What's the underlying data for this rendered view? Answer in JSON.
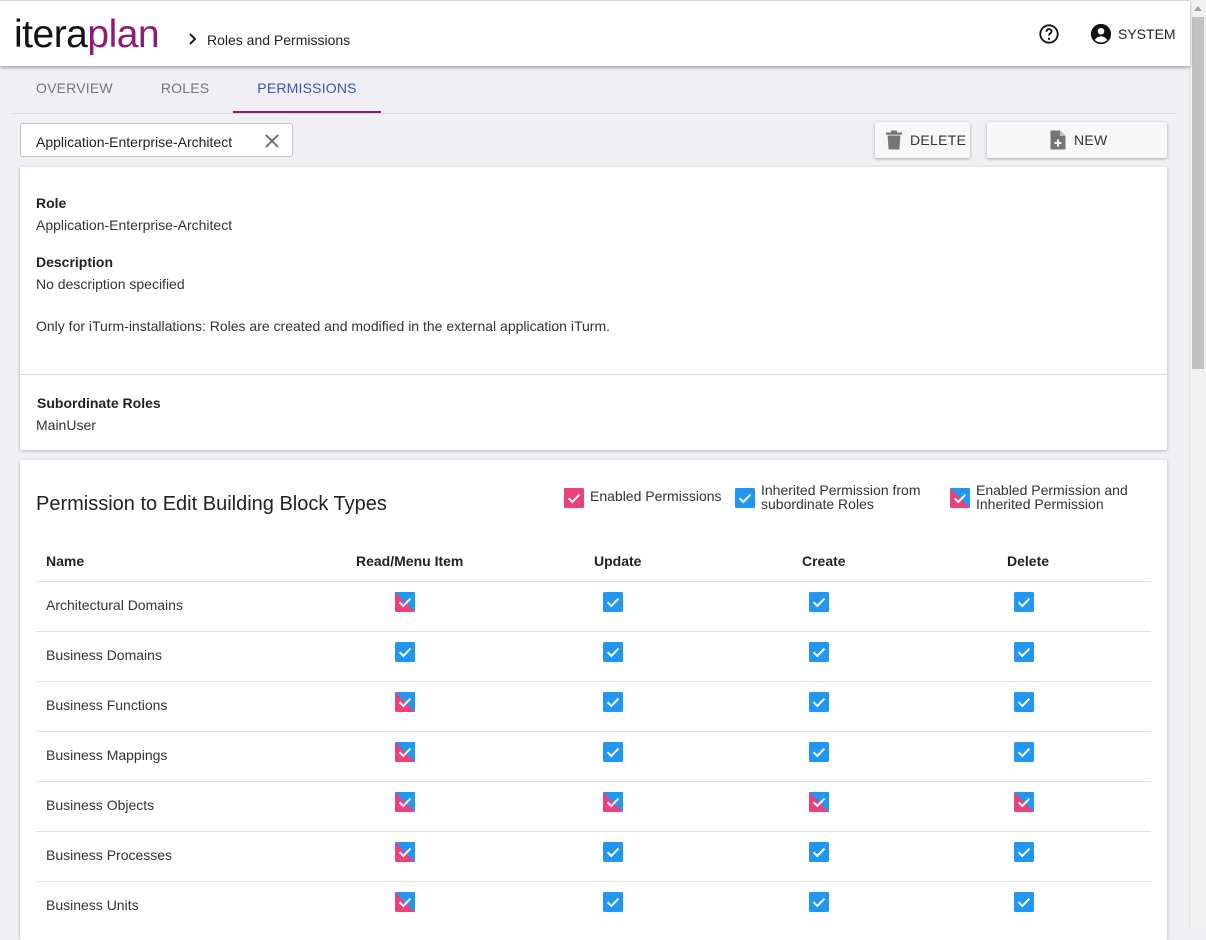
{
  "header": {
    "logo_part1": "itera",
    "logo_part2": "plan",
    "breadcrumb": "Roles and Permissions",
    "help_icon": "help-circle-icon",
    "user_name": "SYSTEM"
  },
  "tabs": [
    {
      "label": "OVERVIEW",
      "active": false
    },
    {
      "label": "ROLES",
      "active": false
    },
    {
      "label": "PERMISSIONS",
      "active": true
    }
  ],
  "role_select": {
    "value": "Application-Enterprise-Architect"
  },
  "toolbar": {
    "delete_label": "DELETE",
    "new_label": "NEW"
  },
  "role_card": {
    "role_label": "Role",
    "role_value": "Application-Enterprise-Architect",
    "description_label": "Description",
    "description_value": "No description specified",
    "note": "Only for iTurm-installations: Roles are created and modified in the external application iTurm.",
    "subordinate_label": "Subordinate Roles",
    "subordinate_value": "MainUser"
  },
  "permissions": {
    "title": "Permission to Edit Building Block Types",
    "legend": {
      "enabled": "Enabled Permissions",
      "inherited_line1": "Inherited Permission from",
      "inherited_line2": "subordinate Roles",
      "both_line1": "Enabled Permission and",
      "both_line2": "Inherited Permission"
    },
    "columns": {
      "name": "Name",
      "read": "Read/Menu Item",
      "update": "Update",
      "create": "Create",
      "delete": "Delete"
    },
    "rows": [
      {
        "name": "Architectural Domains",
        "read": "both",
        "update": "inherited",
        "create": "inherited",
        "delete": "inherited"
      },
      {
        "name": "Business Domains",
        "read": "inherited",
        "update": "inherited",
        "create": "inherited",
        "delete": "inherited"
      },
      {
        "name": "Business Functions",
        "read": "both",
        "update": "inherited",
        "create": "inherited",
        "delete": "inherited"
      },
      {
        "name": "Business Mappings",
        "read": "both",
        "update": "inherited",
        "create": "inherited",
        "delete": "inherited"
      },
      {
        "name": "Business Objects",
        "read": "both",
        "update": "both",
        "create": "both",
        "delete": "both"
      },
      {
        "name": "Business Processes",
        "read": "both",
        "update": "inherited",
        "create": "inherited",
        "delete": "inherited"
      },
      {
        "name": "Business Units",
        "read": "both",
        "update": "inherited",
        "create": "inherited",
        "delete": "inherited"
      }
    ]
  },
  "colors": {
    "brand": "#8e1b7a",
    "tab_active": "#3f51b5",
    "enabled": "#ec407a",
    "inherited": "#2196f3"
  }
}
